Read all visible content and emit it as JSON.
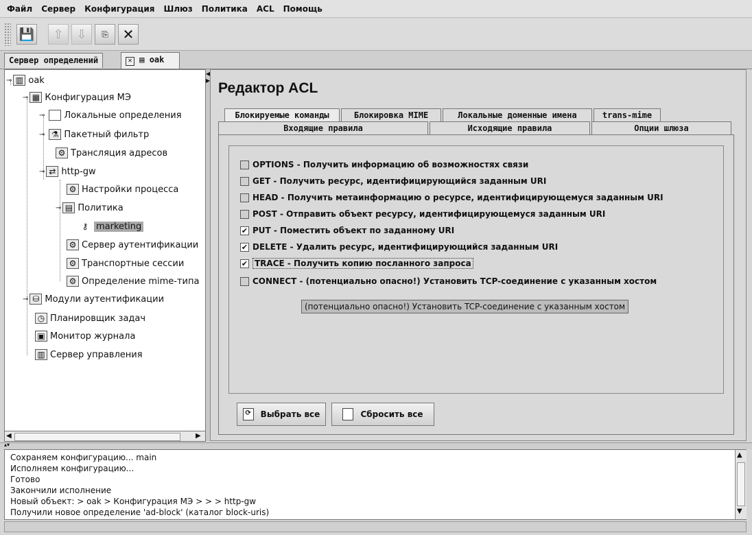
{
  "menu": [
    "Файл",
    "Сервер",
    "Конфигурация",
    "Шлюз",
    "Политика",
    "ACL",
    "Помощь"
  ],
  "toolbar": {
    "save_icon": "floppy-icon",
    "up_icon": "arrow-up-icon",
    "down_icon": "arrow-down-icon",
    "copy_icon": "copy-icon",
    "delete_icon": "x-icon"
  },
  "tabs": {
    "first": "Сервер определений",
    "second": "oak"
  },
  "tree": {
    "root": "oak",
    "fw_config": "Конфигурация МЭ",
    "local_defs": "Локальные определения",
    "packet_filter": "Пакетный фильтр",
    "nat": "Трансляция адресов",
    "http_gw": "http-gw",
    "proc_settings": "Настройки процесса",
    "policy": "Политика",
    "marketing": "marketing",
    "auth_server": "Сервер аутентификации",
    "transport": "Транспортные сессии",
    "mime_def": "Определение mime-типа",
    "auth_modules": "Модули аутентификации",
    "scheduler": "Планировщик задач",
    "log_monitor": "Монитор журнала",
    "mgmt_server": "Сервер управления"
  },
  "editor": {
    "title": "Редактор ACL",
    "tabs_row1": [
      "Блокируемые команды",
      "Блокировка MIME",
      "Локальные доменные имена",
      "trans-mime"
    ],
    "tabs_row2": [
      "Входящие правила",
      "Исходящие правила",
      "Опции шлюза"
    ],
    "commands": [
      {
        "label": "OPTIONS - Получить информацию об возможностях связи",
        "checked": false
      },
      {
        "label": "GET - Получить ресурс, идентифицирующийся заданным URI",
        "checked": false
      },
      {
        "label": "HEAD - Получить метаинформацию о ресурсе, идентифицирующемуся заданным URI",
        "checked": false
      },
      {
        "label": "POST - Отправить объект ресурсу, идентифицирующемуся заданным URI",
        "checked": false
      },
      {
        "label": "PUT - Поместить объект по заданному URI",
        "checked": true
      },
      {
        "label": "DELETE - Удалить ресурс, идентифицирующийся заданным URI",
        "checked": true
      },
      {
        "label": "TRACE - Получить копию посланного запроса",
        "checked": true
      },
      {
        "label": "CONNECT - (потенциально опасно!) Установить TCP-соединение с указанным хостом",
        "checked": false
      }
    ],
    "tooltip": "(потенциально опасно!) Установить TCP-соединение с указанным хостом",
    "select_all": "Выбрать все",
    "reset_all": "Сбросить все"
  },
  "log": [
    "Сохраняем конфигурацию... main",
    "Исполняем конфигурацию...",
    "Готово",
    "Закончили исполнение",
    "Новый объект:  > oak > Конфигурация МЭ > > > http-gw",
    "Получили новое определение 'ad-block' (каталог block-uris)"
  ]
}
